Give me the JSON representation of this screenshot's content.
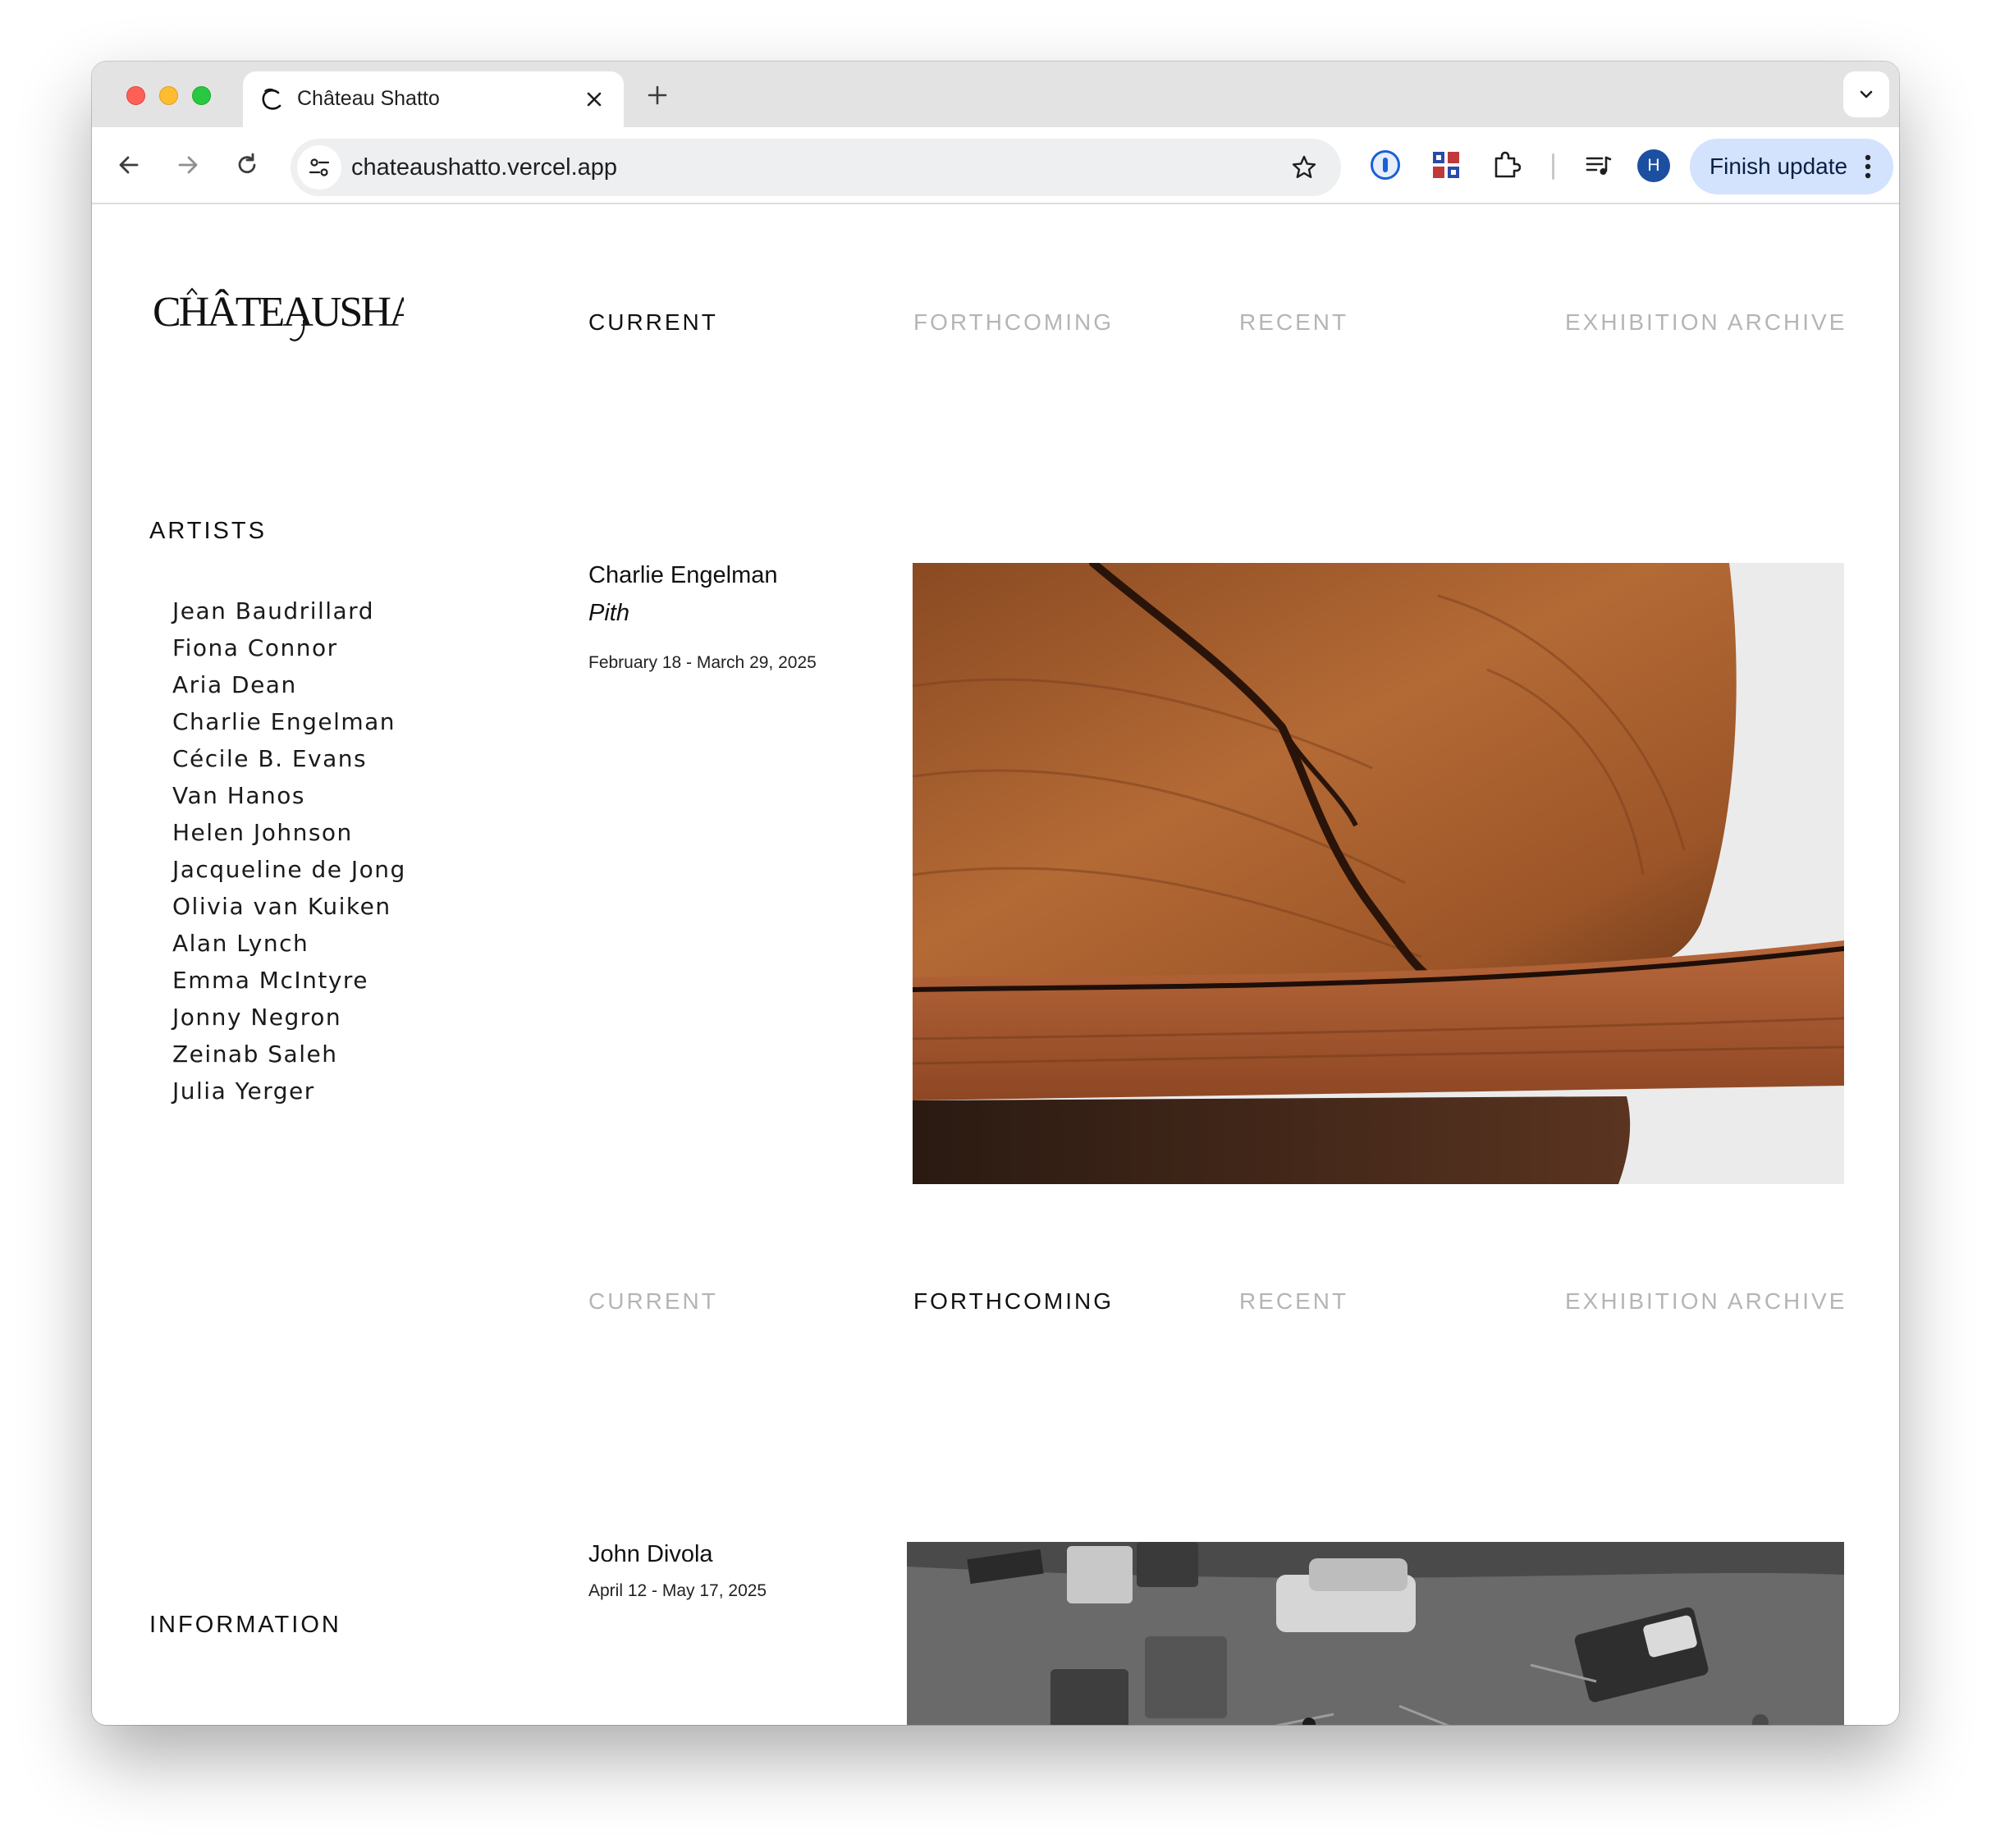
{
  "browser": {
    "tab_title": "Château Shatto",
    "url": "chateaushatto.vercel.app",
    "profile_initial": "H",
    "finish_update_label": "Finish update",
    "icons": [
      "back-icon",
      "forward-icon",
      "reload-icon",
      "site-info-icon",
      "bookmark-star-icon",
      "password-manager-icon",
      "extension-grid-icon",
      "extensions-puzzle-icon",
      "media-controls-icon",
      "more-menu-icon"
    ]
  },
  "site": {
    "logo_text": "CHÂTEAUSHATTO"
  },
  "nav_top": {
    "active": "current",
    "items": [
      "CURRENT",
      "FORTHCOMING",
      "RECENT",
      "EXHIBITION ARCHIVE"
    ]
  },
  "sidebar": {
    "artists_heading": "ARTISTS",
    "artists": [
      "Jean Baudrillard",
      "Fiona Connor",
      "Aria Dean",
      "Charlie Engelman",
      "Cécile B. Evans",
      "Van Hanos",
      "Helen Johnson",
      "Jacqueline de Jong",
      "Olivia van Kuiken",
      "Alan Lynch",
      "Emma McIntyre",
      "Jonny Negron",
      "Zeinab Saleh",
      "Julia Yerger"
    ],
    "information_heading": "INFORMATION"
  },
  "current_exhibition": {
    "artist": "Charlie Engelman",
    "title": "Pith",
    "dates": "February 18 - March 29, 2025"
  },
  "nav_second": {
    "active": "forthcoming",
    "items": [
      "CURRENT",
      "FORTHCOMING",
      "RECENT",
      "EXHIBITION ARCHIVE"
    ]
  },
  "forthcoming_exhibition": {
    "artist": "John Divola",
    "dates": "April 12 - May 17, 2025"
  },
  "colors": {
    "nav_active": "#111111",
    "nav_inactive": "#b5b5b5",
    "finish_update_bg": "#d3e3fd",
    "avatar_bg": "#1d4fa0"
  }
}
